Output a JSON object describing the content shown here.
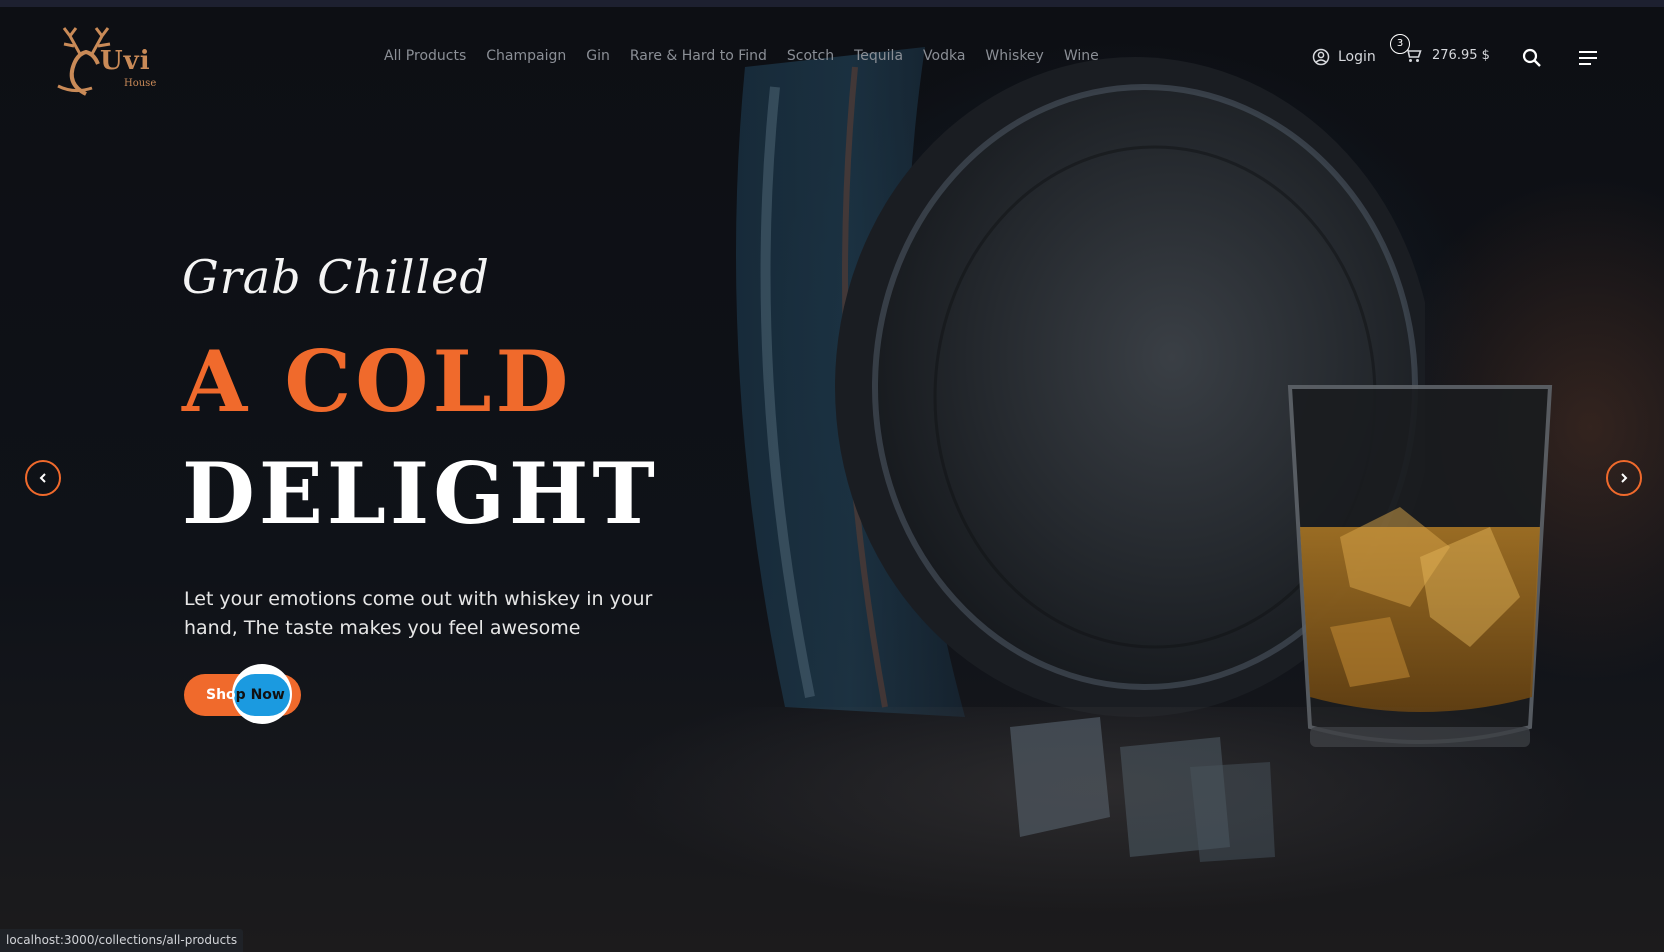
{
  "brand": {
    "name": "Uvi",
    "tagline": "House",
    "color": "#c98a57"
  },
  "nav": {
    "items": [
      {
        "label": "All Products"
      },
      {
        "label": "Champaign"
      },
      {
        "label": "Gin"
      },
      {
        "label": "Rare & Hard to Find"
      },
      {
        "label": "Scotch"
      },
      {
        "label": "Tequila"
      },
      {
        "label": "Vodka"
      },
      {
        "label": "Whiskey"
      },
      {
        "label": "Wine"
      }
    ]
  },
  "header": {
    "login_label": "Login",
    "cart_count": "3",
    "cart_total": "276.95 $",
    "icons": [
      "user-circle-icon",
      "cart-icon",
      "search-icon",
      "menu-icon"
    ]
  },
  "hero": {
    "script_title": "Grab Chilled",
    "headline_line1": "A COLD",
    "headline_line2": "DELIGHT",
    "description": "Let your emotions come out with whiskey in your hand, The taste makes you feel awesome",
    "cta_part1": "Sho",
    "cta_part2": "p Now",
    "accent_color": "#f06a2c"
  },
  "carousel": {
    "prev_icon": "chevron-left-icon",
    "next_icon": "chevron-right-icon"
  },
  "status_bar": {
    "url": "localhost:3000/collections/all-products"
  }
}
